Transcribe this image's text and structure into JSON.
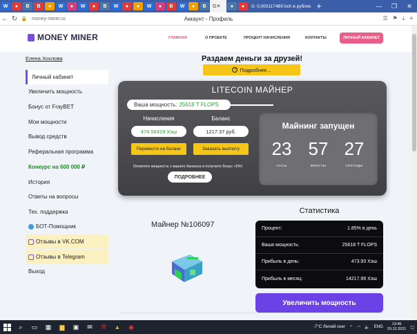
{
  "browser": {
    "active_tab_icon": "G",
    "wide_tab_title": "0,0001174B0 bch в рублях",
    "url": "money-miner.cc",
    "page_title": "Аккаунт - Профиль"
  },
  "header": {
    "logo_text": "MONEY MINER",
    "nav": [
      "ГЛАВНАЯ",
      "О ПРОЕКТЕ",
      "ПРОЦЕНТ НАЧИСЛЕНИЯ",
      "КОНТАКТЫ"
    ],
    "cabinet_button": "ЛИЧНЫЙ КАБИНЕТ",
    "accent": "#e8608a",
    "brand": "#7b4ce0"
  },
  "sidebar": {
    "username": "Елена Хохлова",
    "items": [
      {
        "label": "Личный кабинет"
      },
      {
        "label": "Увеличить мощность"
      },
      {
        "label": "Бонус от FrayBET"
      },
      {
        "label": "Мои мощности"
      },
      {
        "label": "Вывод средств"
      },
      {
        "label": "Реферальная программа"
      },
      {
        "label": "Конкурс на 600 000 ₽"
      },
      {
        "label": "История"
      },
      {
        "label": "Ответы на вопросы"
      },
      {
        "label": "Тех. поддержка"
      },
      {
        "label": "БОТ-Помощник"
      },
      {
        "label": "Отзывы в VK.COM"
      },
      {
        "label": "Отзывы в Telegram"
      },
      {
        "label": "Выход"
      }
    ]
  },
  "promo": {
    "text": "Раздаем деньги за друзей!",
    "button": "Подробнее..."
  },
  "miner": {
    "title": "LITECOIN МАЙНЕР",
    "power_label": "Ваша мощность:",
    "power_value": "25618 T FLOPS",
    "accruals_label": "Начисления",
    "accruals_value": "474.56429 Хэш",
    "balance_label": "Баланс",
    "balance_value": "1217.37 руб.",
    "transfer_button": "Перевести на баланс",
    "payout_button": "Заказать выплату",
    "note": "Оплатите мощность с вашего баланса и получите бонус +5%!",
    "more_button": "ПОДРОБНЕЕ",
    "status": "Майнинг запущен",
    "timer": [
      {
        "value": "23",
        "label": "ЧАСЫ"
      },
      {
        "value": "57",
        "label": "МИНУТЫ"
      },
      {
        "value": "27",
        "label": "СЕКУНДЫ"
      }
    ]
  },
  "miner_id": "Майнер №106097",
  "stats": {
    "title": "Статистика",
    "rows": [
      {
        "label": "Процент:",
        "value": "1.85% в день"
      },
      {
        "label": "Ваша мощность:",
        "value": "25618 T FLOPS"
      },
      {
        "label": "Прибыль в день:",
        "value": "473.93 Хэш"
      },
      {
        "label": "Прибыль в месяц:",
        "value": "14217.99 Хэш"
      }
    ],
    "increase_button": "Увеличить мощность"
  },
  "taskbar": {
    "weather": "-7°C  Легкий снег",
    "lang": "ENG",
    "time": "13:45",
    "date": "29.12.2021"
  }
}
